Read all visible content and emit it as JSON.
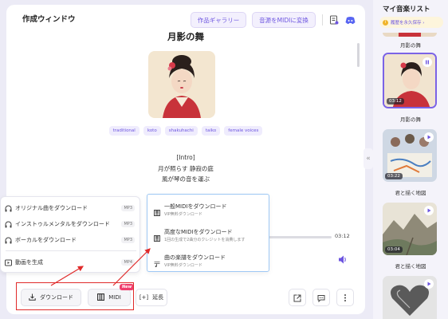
{
  "window": {
    "title": "作成ウィンドウ",
    "gallery_button": "作品ギャラリー",
    "midi_convert_button": "音源をMIDIに変換"
  },
  "song": {
    "title": "月影の舞",
    "tags": [
      "traditional",
      "koto",
      "shakuhachi",
      "taiko",
      "female voices"
    ],
    "lyrics": [
      "[Intro]",
      "月が照らす 静寂の庭",
      "風が琴の音を運ぶ"
    ]
  },
  "player": {
    "duration": "03:12"
  },
  "download_menu": {
    "items": [
      {
        "label": "オリジナル曲をダウンロード",
        "format": "MP3",
        "icon": "headphones-icon"
      },
      {
        "label": "インストゥルメンタルをダウンロード",
        "format": "MP3",
        "icon": "headphones-icon"
      },
      {
        "label": "ボーカルをダウンロード",
        "format": "MP3",
        "icon": "headphones-icon"
      },
      {
        "label": "動画を生成",
        "format": "MP4",
        "icon": "video-icon"
      }
    ]
  },
  "midi_menu": {
    "items": [
      {
        "title": "一般MIDIをダウンロード",
        "subtitle": "VIP無料ダウンロード"
      },
      {
        "title": "高度なMIDIをダウンロード",
        "subtitle": "1回の生成で2曲分のクレジットを消費します"
      },
      {
        "title": "曲の楽譜をダウンロード",
        "subtitle": "VIP無料ダウンロード"
      }
    ]
  },
  "bottom": {
    "download_button": "ダウンロード",
    "midi_button": "MIDI",
    "midi_badge": "New",
    "extend_button": "延長"
  },
  "sidebar": {
    "title": "マイ音楽リスト",
    "notice": "履歴を永久保存 ›",
    "items": [
      {
        "title": "月影の舞",
        "duration": ""
      },
      {
        "title": "月影の舞",
        "duration": "03:12"
      },
      {
        "title": "君と描く地図",
        "duration": "03:22"
      },
      {
        "title": "君と描く地図",
        "duration": "03:04"
      },
      {
        "title": "",
        "duration": ""
      }
    ]
  },
  "colors": {
    "accent": "#6d55e0",
    "highlight_red": "#e02a2a",
    "new_badge": "#ef3e6c",
    "midi_menu_border": "#9ec8f4"
  }
}
